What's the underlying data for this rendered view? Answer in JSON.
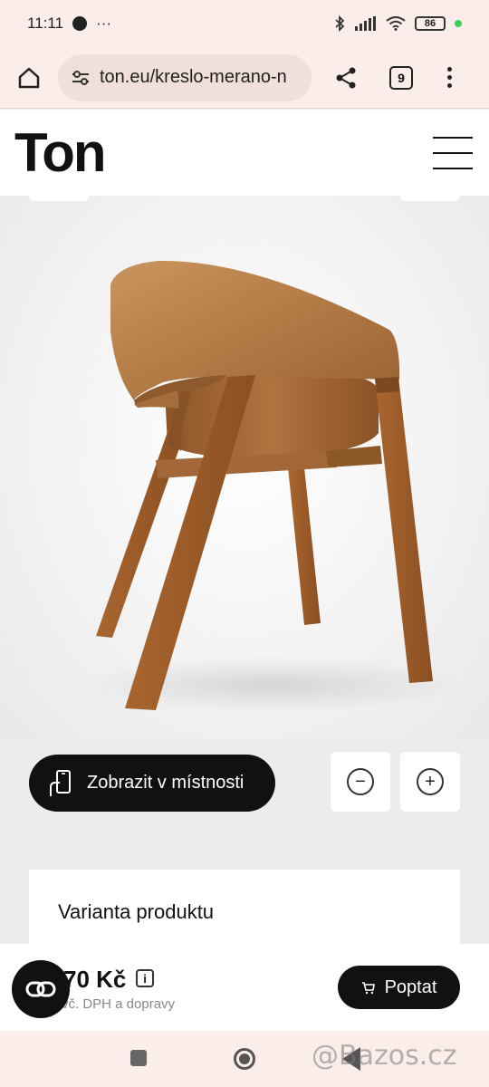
{
  "status_bar": {
    "time": "11:11",
    "more": "···",
    "battery": "86"
  },
  "browser": {
    "url": "ton.eu/kreslo-merano-n",
    "tab_count": "9"
  },
  "site": {
    "logo": "Ton"
  },
  "product": {
    "ar_button_label": "Zobrazit v místnosti",
    "zoom_out": "−",
    "zoom_in": "+",
    "variant_title": "Varianta produktu",
    "price": "70 Kč",
    "price_note": "vč. DPH a dopravy",
    "inquire_label": "Poptat"
  },
  "watermark": "@Bazos.cz",
  "colors": {
    "accent": "#111111",
    "chrome": "#fbeeea",
    "wood": "#a8683a"
  }
}
